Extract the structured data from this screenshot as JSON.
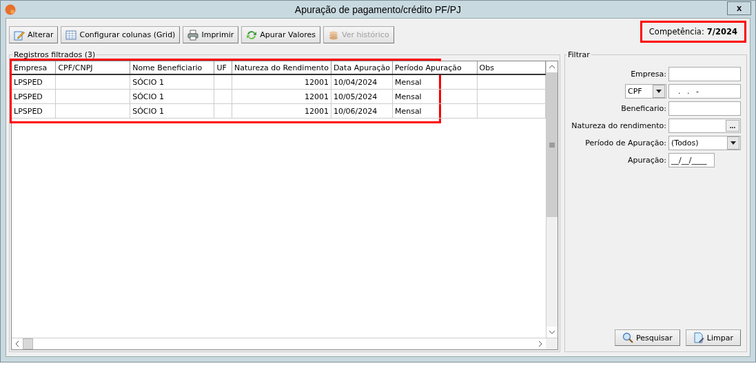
{
  "window": {
    "title": "Apuração de pagamento/crédito PF/PJ",
    "close": "x"
  },
  "toolbar": [
    {
      "label": "Alterar",
      "kind": "edit",
      "disabled": false
    },
    {
      "label": "Configurar colunas (Grid)",
      "kind": "grid",
      "disabled": false
    },
    {
      "label": "Imprimir",
      "kind": "print",
      "disabled": false
    },
    {
      "label": "Apurar Valores",
      "kind": "refresh",
      "disabled": false
    },
    {
      "label": "Ver histórico",
      "kind": "history",
      "disabled": true
    }
  ],
  "competencia": {
    "label": "Competência:",
    "value": "7/2024",
    "highlighted": true
  },
  "records": {
    "title": "Registros filtrados (3)",
    "highlighted": true,
    "columns": [
      "Empresa",
      "CPF/CNPJ",
      "Nome Beneficiario",
      "UF",
      "Natureza do Rendimento",
      "Data Apuração",
      "Período Apuração",
      "Obs"
    ],
    "rows": [
      [
        "LPSPED",
        "",
        "SÓCIO 1",
        "",
        "12001",
        "10/04/2024",
        "Mensal",
        ""
      ],
      [
        "LPSPED",
        "",
        "SÓCIO 1",
        "",
        "12001",
        "10/05/2024",
        "Mensal",
        ""
      ],
      [
        "LPSPED",
        "",
        "SÓCIO 1",
        "",
        "12001",
        "10/06/2024",
        "Mensal",
        ""
      ]
    ]
  },
  "filter": {
    "title": "Filtrar",
    "fields": [
      {
        "kind": "text",
        "label": "Empresa:"
      },
      {
        "kind": "doc",
        "select": "CPF",
        "value": ". . -"
      },
      {
        "kind": "text",
        "label": "Beneficario:"
      },
      {
        "kind": "lookup",
        "label": "Natureza do rendimento:",
        "button": "..."
      },
      {
        "kind": "select",
        "label": "Período de Apuração:",
        "value": "(Todos)"
      },
      {
        "kind": "date",
        "label": "Apuração:",
        "value": "__/__/____"
      }
    ],
    "buttons": [
      {
        "label": "Pesquisar",
        "kind": "search"
      },
      {
        "label": "Limpar",
        "kind": "clear"
      }
    ]
  }
}
